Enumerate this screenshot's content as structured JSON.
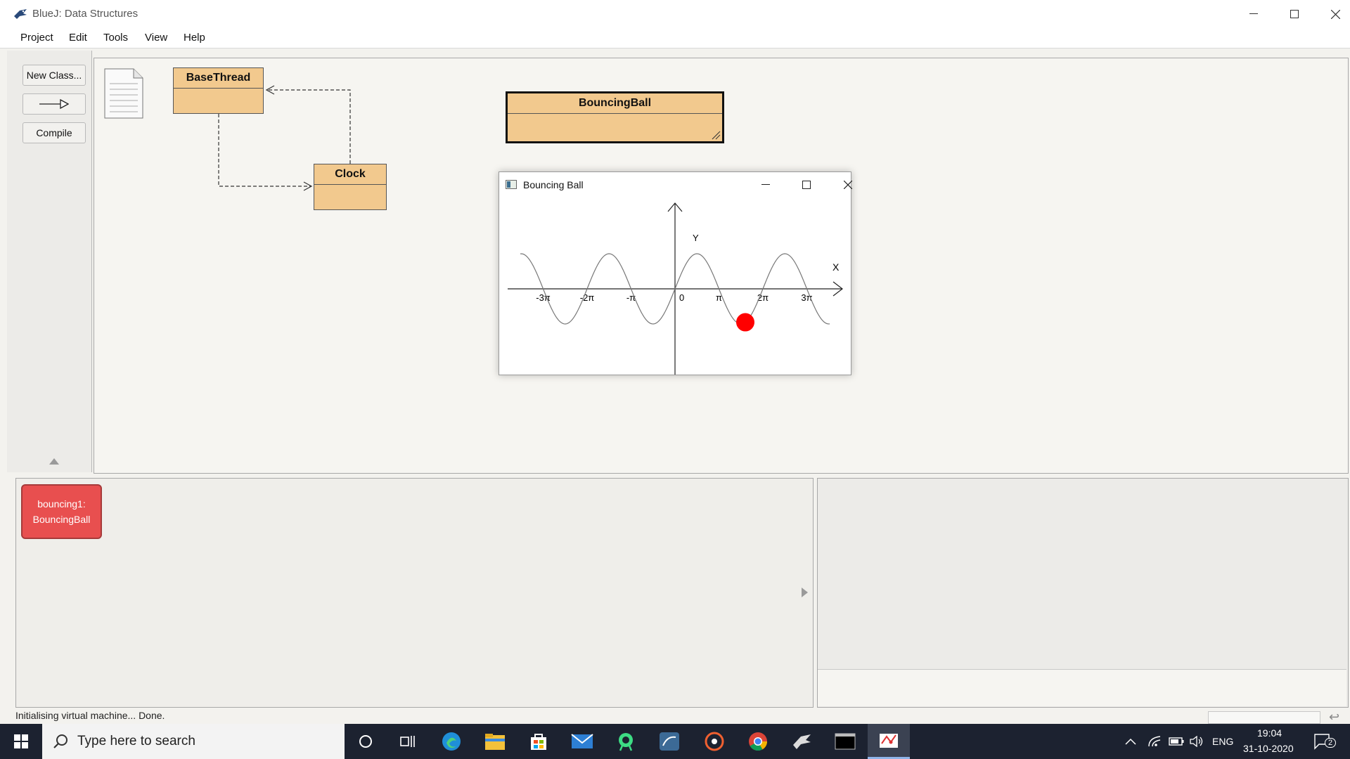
{
  "window": {
    "title": "BlueJ:  Data Structures"
  },
  "menu": [
    "Project",
    "Edit",
    "Tools",
    "View",
    "Help"
  ],
  "tools": {
    "new_class": "New Class...",
    "compile": "Compile"
  },
  "classes": {
    "base_thread": "BaseThread",
    "clock": "Clock",
    "bouncing_ball": "BouncingBall"
  },
  "bouncing_window": {
    "title": "Bouncing Ball",
    "y_label": "Y",
    "x_label": "X",
    "x_ticks": [
      "-3π",
      "-2π",
      "-π",
      "0",
      "π",
      "2π",
      "3π"
    ],
    "ball_color": "#ff0000",
    "ball_x_pi": 1.6
  },
  "object_bench": {
    "object_line1": "bouncing1:",
    "object_line2": "BouncingBall"
  },
  "status": "Initialising virtual machine... Done.",
  "taskbar": {
    "search_placeholder": "Type here to search",
    "language": "ENG",
    "time": "19:04",
    "date": "31-10-2020",
    "notification_count": "2"
  },
  "colors": {
    "class_fill": "#f2c98e",
    "object_fill": "#e84f4f",
    "taskbar": "#1c2230"
  }
}
